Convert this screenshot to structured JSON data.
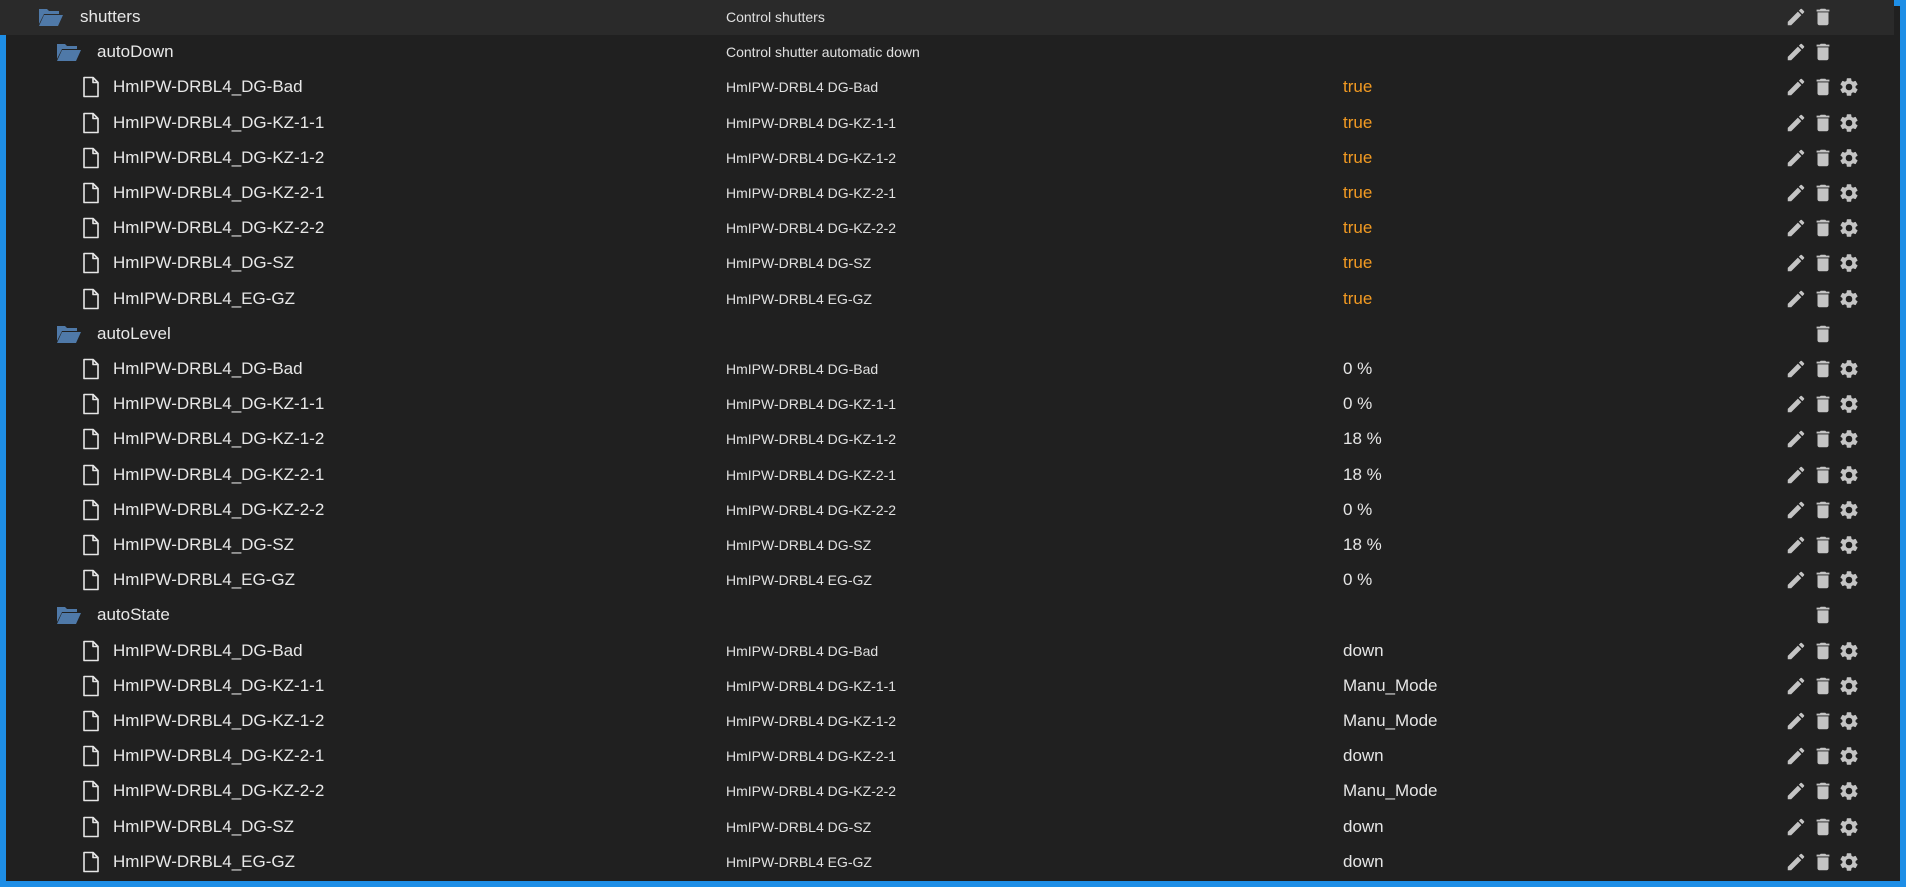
{
  "colors": {
    "border": "#1e8ee6",
    "background": "#202020",
    "boolean_value": "#f29a22",
    "folder_icon": "#4f79a8",
    "action_icon": "#c4c4c4"
  },
  "rows": [
    {
      "type": "folder",
      "level": 0,
      "name": "shutters",
      "desc": "Control shutters",
      "value": "",
      "actions": [
        "pencil-icon",
        "trash-icon"
      ]
    },
    {
      "type": "folder",
      "level": 1,
      "name": "autoDown",
      "desc": "Control shutter automatic down",
      "value": "",
      "actions": [
        "pencil-icon",
        "trash-icon"
      ]
    },
    {
      "type": "file",
      "level": 2,
      "name": "HmIPW-DRBL4_DG-Bad",
      "desc": "HmIPW-DRBL4 DG-Bad",
      "value": "true",
      "bool": true,
      "actions": [
        "pencil-icon",
        "trash-icon",
        "gear-icon"
      ]
    },
    {
      "type": "file",
      "level": 2,
      "name": "HmIPW-DRBL4_DG-KZ-1-1",
      "desc": "HmIPW-DRBL4 DG-KZ-1-1",
      "value": "true",
      "bool": true,
      "actions": [
        "pencil-icon",
        "trash-icon",
        "gear-icon"
      ]
    },
    {
      "type": "file",
      "level": 2,
      "name": "HmIPW-DRBL4_DG-KZ-1-2",
      "desc": "HmIPW-DRBL4 DG-KZ-1-2",
      "value": "true",
      "bool": true,
      "actions": [
        "pencil-icon",
        "trash-icon",
        "gear-icon"
      ]
    },
    {
      "type": "file",
      "level": 2,
      "name": "HmIPW-DRBL4_DG-KZ-2-1",
      "desc": "HmIPW-DRBL4 DG-KZ-2-1",
      "value": "true",
      "bool": true,
      "actions": [
        "pencil-icon",
        "trash-icon",
        "gear-icon"
      ]
    },
    {
      "type": "file",
      "level": 2,
      "name": "HmIPW-DRBL4_DG-KZ-2-2",
      "desc": "HmIPW-DRBL4 DG-KZ-2-2",
      "value": "true",
      "bool": true,
      "actions": [
        "pencil-icon",
        "trash-icon",
        "gear-icon"
      ]
    },
    {
      "type": "file",
      "level": 2,
      "name": "HmIPW-DRBL4_DG-SZ",
      "desc": "HmIPW-DRBL4 DG-SZ",
      "value": "true",
      "bool": true,
      "actions": [
        "pencil-icon",
        "trash-icon",
        "gear-icon"
      ]
    },
    {
      "type": "file",
      "level": 2,
      "name": "HmIPW-DRBL4_EG-GZ",
      "desc": "HmIPW-DRBL4 EG-GZ",
      "value": "true",
      "bool": true,
      "actions": [
        "pencil-icon",
        "trash-icon",
        "gear-icon"
      ]
    },
    {
      "type": "folder",
      "level": 1,
      "name": "autoLevel",
      "desc": "",
      "value": "",
      "actions": [
        "trash-icon"
      ]
    },
    {
      "type": "file",
      "level": 2,
      "name": "HmIPW-DRBL4_DG-Bad",
      "desc": "HmIPW-DRBL4 DG-Bad",
      "value": "0 %",
      "actions": [
        "pencil-icon",
        "trash-icon",
        "gear-icon"
      ]
    },
    {
      "type": "file",
      "level": 2,
      "name": "HmIPW-DRBL4_DG-KZ-1-1",
      "desc": "HmIPW-DRBL4 DG-KZ-1-1",
      "value": "0 %",
      "actions": [
        "pencil-icon",
        "trash-icon",
        "gear-icon"
      ]
    },
    {
      "type": "file",
      "level": 2,
      "name": "HmIPW-DRBL4_DG-KZ-1-2",
      "desc": "HmIPW-DRBL4 DG-KZ-1-2",
      "value": "18 %",
      "actions": [
        "pencil-icon",
        "trash-icon",
        "gear-icon"
      ]
    },
    {
      "type": "file",
      "level": 2,
      "name": "HmIPW-DRBL4_DG-KZ-2-1",
      "desc": "HmIPW-DRBL4 DG-KZ-2-1",
      "value": "18 %",
      "actions": [
        "pencil-icon",
        "trash-icon",
        "gear-icon"
      ]
    },
    {
      "type": "file",
      "level": 2,
      "name": "HmIPW-DRBL4_DG-KZ-2-2",
      "desc": "HmIPW-DRBL4 DG-KZ-2-2",
      "value": "0 %",
      "actions": [
        "pencil-icon",
        "trash-icon",
        "gear-icon"
      ]
    },
    {
      "type": "file",
      "level": 2,
      "name": "HmIPW-DRBL4_DG-SZ",
      "desc": "HmIPW-DRBL4 DG-SZ",
      "value": "18 %",
      "actions": [
        "pencil-icon",
        "trash-icon",
        "gear-icon"
      ]
    },
    {
      "type": "file",
      "level": 2,
      "name": "HmIPW-DRBL4_EG-GZ",
      "desc": "HmIPW-DRBL4 EG-GZ",
      "value": "0 %",
      "actions": [
        "pencil-icon",
        "trash-icon",
        "gear-icon"
      ]
    },
    {
      "type": "folder",
      "level": 1,
      "name": "autoState",
      "desc": "",
      "value": "",
      "actions": [
        "trash-icon"
      ]
    },
    {
      "type": "file",
      "level": 2,
      "name": "HmIPW-DRBL4_DG-Bad",
      "desc": "HmIPW-DRBL4 DG-Bad",
      "value": "down",
      "actions": [
        "pencil-icon",
        "trash-icon",
        "gear-icon"
      ]
    },
    {
      "type": "file",
      "level": 2,
      "name": "HmIPW-DRBL4_DG-KZ-1-1",
      "desc": "HmIPW-DRBL4 DG-KZ-1-1",
      "value": "Manu_Mode",
      "actions": [
        "pencil-icon",
        "trash-icon",
        "gear-icon"
      ]
    },
    {
      "type": "file",
      "level": 2,
      "name": "HmIPW-DRBL4_DG-KZ-1-2",
      "desc": "HmIPW-DRBL4 DG-KZ-1-2",
      "value": "Manu_Mode",
      "actions": [
        "pencil-icon",
        "trash-icon",
        "gear-icon"
      ]
    },
    {
      "type": "file",
      "level": 2,
      "name": "HmIPW-DRBL4_DG-KZ-2-1",
      "desc": "HmIPW-DRBL4 DG-KZ-2-1",
      "value": "down",
      "actions": [
        "pencil-icon",
        "trash-icon",
        "gear-icon"
      ]
    },
    {
      "type": "file",
      "level": 2,
      "name": "HmIPW-DRBL4_DG-KZ-2-2",
      "desc": "HmIPW-DRBL4 DG-KZ-2-2",
      "value": "Manu_Mode",
      "actions": [
        "pencil-icon",
        "trash-icon",
        "gear-icon"
      ]
    },
    {
      "type": "file",
      "level": 2,
      "name": "HmIPW-DRBL4_DG-SZ",
      "desc": "HmIPW-DRBL4 DG-SZ",
      "value": "down",
      "actions": [
        "pencil-icon",
        "trash-icon",
        "gear-icon"
      ]
    },
    {
      "type": "file",
      "level": 2,
      "name": "HmIPW-DRBL4_EG-GZ",
      "desc": "HmIPW-DRBL4 EG-GZ",
      "value": "down",
      "actions": [
        "pencil-icon",
        "trash-icon",
        "gear-icon"
      ]
    }
  ]
}
